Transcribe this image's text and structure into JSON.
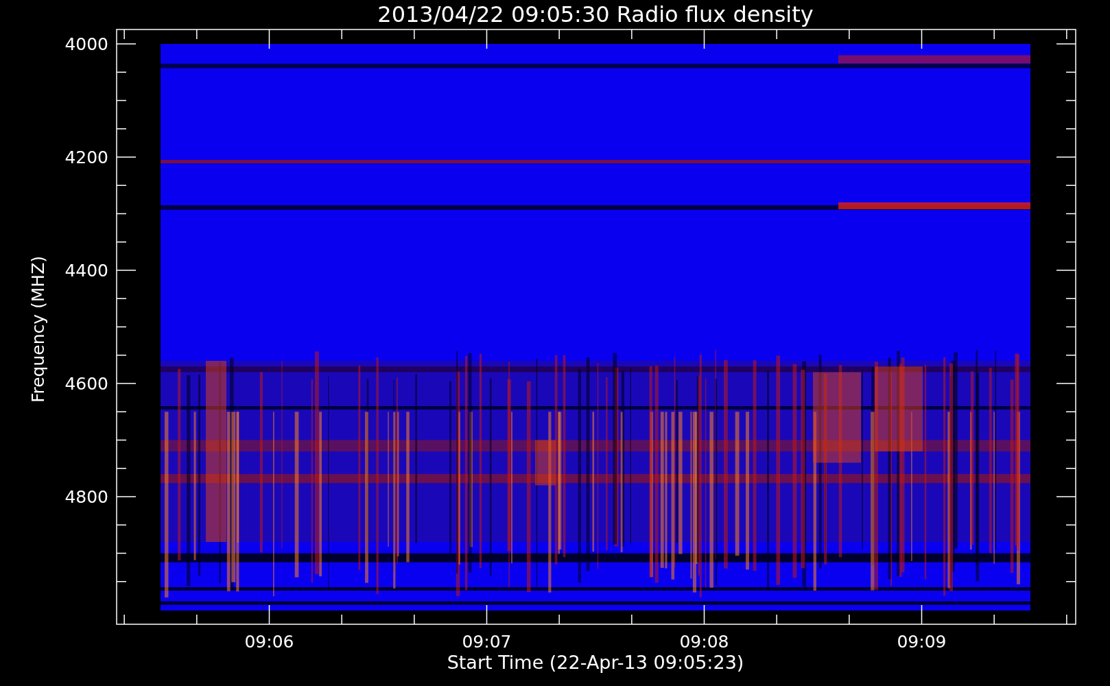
{
  "title": "2013/04/22 09:05:30 Radio flux density",
  "y_axis": {
    "label": "Frequency (MHZ)",
    "ticks": [
      "4000",
      "4200",
      "4400",
      "4600",
      "4800"
    ]
  },
  "x_axis": {
    "label": "Start Time (22-Apr-13 09:05:23)",
    "ticks": [
      "09:06",
      "09:07",
      "09:08",
      "09:09"
    ]
  }
}
